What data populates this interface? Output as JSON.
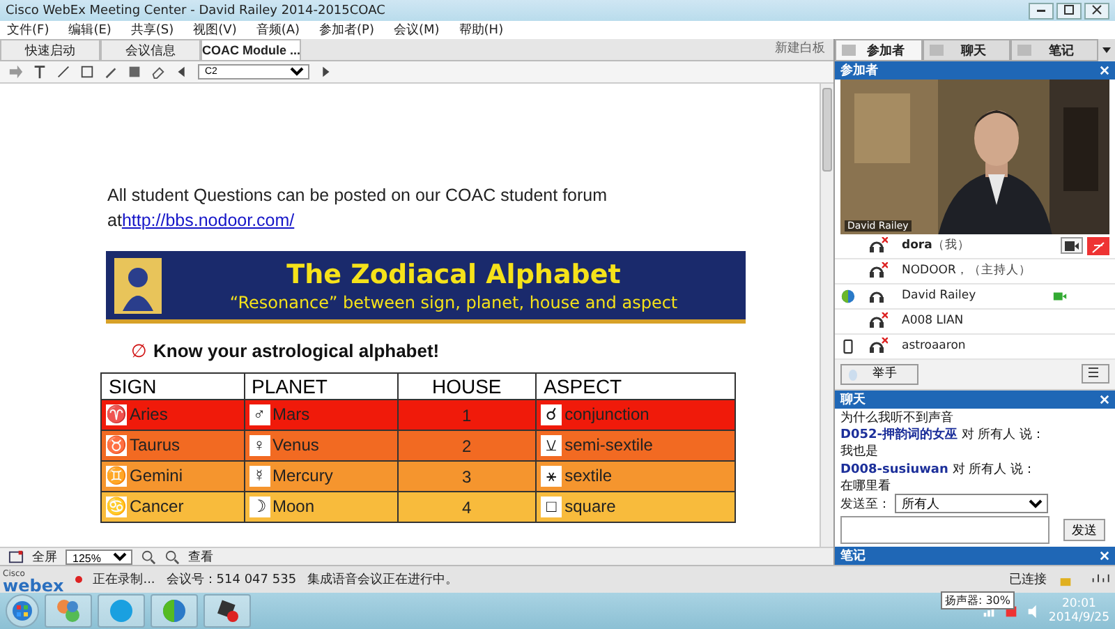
{
  "window": {
    "title": "Cisco WebEx Meeting Center - David Railey 2014-2015COAC"
  },
  "menu": [
    "文件(F)",
    "编辑(E)",
    "共享(S)",
    "视图(V)",
    "音频(A)",
    "参加者(P)",
    "会议(M)",
    "帮助(H)"
  ],
  "tabs": [
    {
      "label": "快速启动",
      "selected": false
    },
    {
      "label": "会议信息",
      "selected": false
    },
    {
      "label": "COAC Module ...",
      "selected": true
    }
  ],
  "toolbar": {
    "page": "C2",
    "new_whiteboard": "新建白板"
  },
  "document": {
    "intro": "All student Questions can be posted on our COAC student forum",
    "intro_prefix": "at",
    "link": "http://bbs.nodoor.com/",
    "banner": {
      "title": "The Zodiacal Alphabet",
      "subtitle": "“Resonance” between sign, planet, house and aspect"
    },
    "heading_mark": "∅",
    "heading": "Know your astrological alphabet!",
    "table": {
      "columns": [
        "SIGN",
        "PLANET",
        "HOUSE",
        "ASPECT"
      ],
      "rows": [
        {
          "color": "#f01a0a",
          "cells": [
            {
              "symbol": "♈",
              "text": "Aries"
            },
            {
              "symbol": "♂",
              "text": "Mars"
            },
            {
              "text": "1"
            },
            {
              "symbol": "☌",
              "text": "conjunction"
            }
          ]
        },
        {
          "color": "#f26a22",
          "cells": [
            {
              "symbol": "♉",
              "text": "Taurus"
            },
            {
              "symbol": "♀",
              "text": "Venus"
            },
            {
              "text": "2"
            },
            {
              "symbol": "⚺",
              "text": "semi-sextile"
            }
          ]
        },
        {
          "color": "#f5952e",
          "cells": [
            {
              "symbol": "♊",
              "text": "Gemini"
            },
            {
              "symbol": "☿",
              "text": "Mercury"
            },
            {
              "text": "3"
            },
            {
              "symbol": "⚹",
              "text": "sextile"
            }
          ]
        },
        {
          "color": "#f8bb3c",
          "cells": [
            {
              "symbol": "♋",
              "text": "Cancer"
            },
            {
              "symbol": "☽",
              "text": "Moon"
            },
            {
              "text": "4"
            },
            {
              "symbol": "□",
              "text": "square"
            }
          ]
        }
      ]
    }
  },
  "view_bar": {
    "full_screen": "全屏",
    "zoom": "125%",
    "view": "查看"
  },
  "side_tabs": [
    {
      "label": "参加者",
      "selected": true
    },
    {
      "label": "聊天",
      "selected": false
    },
    {
      "label": "笔记",
      "selected": false
    }
  ],
  "participants_panel": {
    "title": "参加者",
    "video_name": "David Railey",
    "participants": [
      {
        "name": "dora",
        "note": "（我）",
        "kind": "plain",
        "me": true,
        "muted": true,
        "video": false
      },
      {
        "name": "NODOOR",
        "note": "，（主持人）",
        "kind": "plain",
        "me": false,
        "muted": true,
        "video": false
      },
      {
        "name": "David Railey",
        "kind": "web",
        "me": false,
        "muted": false,
        "video": true
      },
      {
        "name": "A008 LIAN",
        "kind": "plain",
        "me": false,
        "muted": true,
        "video": false
      },
      {
        "name": "astroaaron",
        "kind": "phone",
        "me": false,
        "muted": true,
        "video": false
      }
    ],
    "raise_hand": "举手"
  },
  "chat": {
    "title": "聊天",
    "messages": [
      {
        "kind": "text",
        "text": "为什么我听不到声音"
      },
      {
        "kind": "sender",
        "name": "D052-押韵词的女巫",
        "to": "对 所有人 说："
      },
      {
        "kind": "text",
        "text": "我也是"
      },
      {
        "kind": "gap"
      },
      {
        "kind": "sender",
        "name": "D008-susiuwan",
        "to": "对 所有人 说："
      },
      {
        "kind": "text",
        "text": "在哪里看"
      }
    ],
    "send_to_label": "发送至：",
    "send_to": "所有人",
    "send": "发送"
  },
  "notes": {
    "title": "笔记"
  },
  "status_bar": {
    "logo_small": "Cisco",
    "logo": "webex",
    "recording": "正在录制...",
    "meeting_number": "会议号：514 047 535",
    "audio": "集成语音会议正在进行中。",
    "connection": "已连接"
  },
  "taskbar": {
    "tooltip": "扬声器: 30%",
    "time": "20:01",
    "date": "2014/9/25"
  }
}
